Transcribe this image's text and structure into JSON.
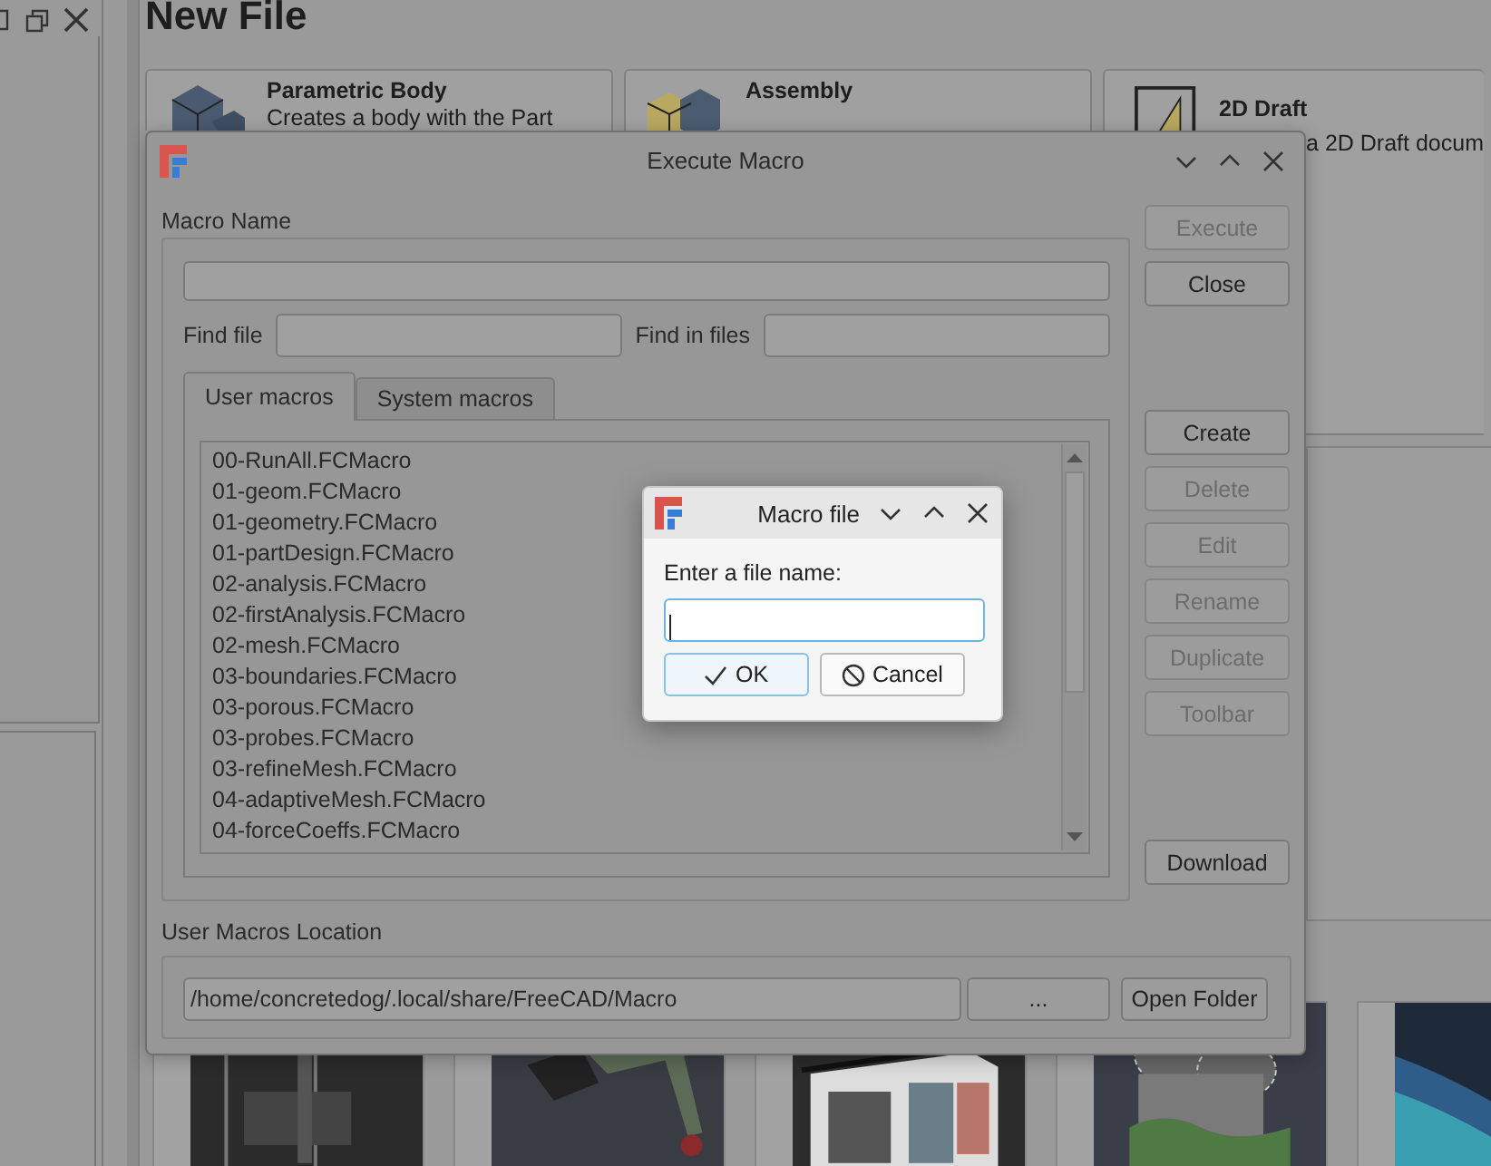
{
  "main_window": {
    "heading": "New File",
    "cards": [
      {
        "title": "Parametric Body",
        "description": "Creates a body with the Part"
      },
      {
        "title": "Assembly"
      },
      {
        "title": "2D Draft",
        "description": "a 2D Draft docum"
      }
    ]
  },
  "execute_macro": {
    "title": "Execute Macro",
    "macro_name_label": "Macro Name",
    "find_file_label": "Find file",
    "find_in_files_label": "Find in files",
    "tabs": [
      {
        "label": "User macros",
        "selected": true
      },
      {
        "label": "System macros",
        "selected": false
      }
    ],
    "macros": [
      "00-RunAll.FCMacro",
      "01-geom.FCMacro",
      "01-geometry.FCMacro",
      "01-partDesign.FCMacro",
      "02-analysis.FCMacro",
      "02-firstAnalysis.FCMacro",
      "02-mesh.FCMacro",
      "03-boundaries.FCMacro",
      "03-porous.FCMacro",
      "03-probes.FCMacro",
      "03-refineMesh.FCMacro",
      "04-adaptiveMesh.FCMacro",
      "04-forceCoeffs.FCMacro"
    ],
    "top_buttons": [
      {
        "label": "Execute",
        "disabled": true
      },
      {
        "label": "Close",
        "disabled": false
      }
    ],
    "side_buttons": [
      {
        "label": "Create",
        "disabled": false
      },
      {
        "label": "Delete",
        "disabled": true
      },
      {
        "label": "Edit",
        "disabled": true
      },
      {
        "label": "Rename",
        "disabled": true
      },
      {
        "label": "Duplicate",
        "disabled": true
      },
      {
        "label": "Toolbar",
        "disabled": true
      }
    ],
    "bottom_buttons": [
      {
        "label": "Download",
        "disabled": false
      }
    ],
    "location_label": "User Macros Location",
    "location_path": "/home/concretedog/.local/share/FreeCAD/Macro",
    "browse_button": "...",
    "open_folder_button": "Open Folder"
  },
  "macro_file_dialog": {
    "title": "Macro file",
    "prompt": "Enter a file name:",
    "ok_button": "OK",
    "cancel_button": "Cancel"
  }
}
